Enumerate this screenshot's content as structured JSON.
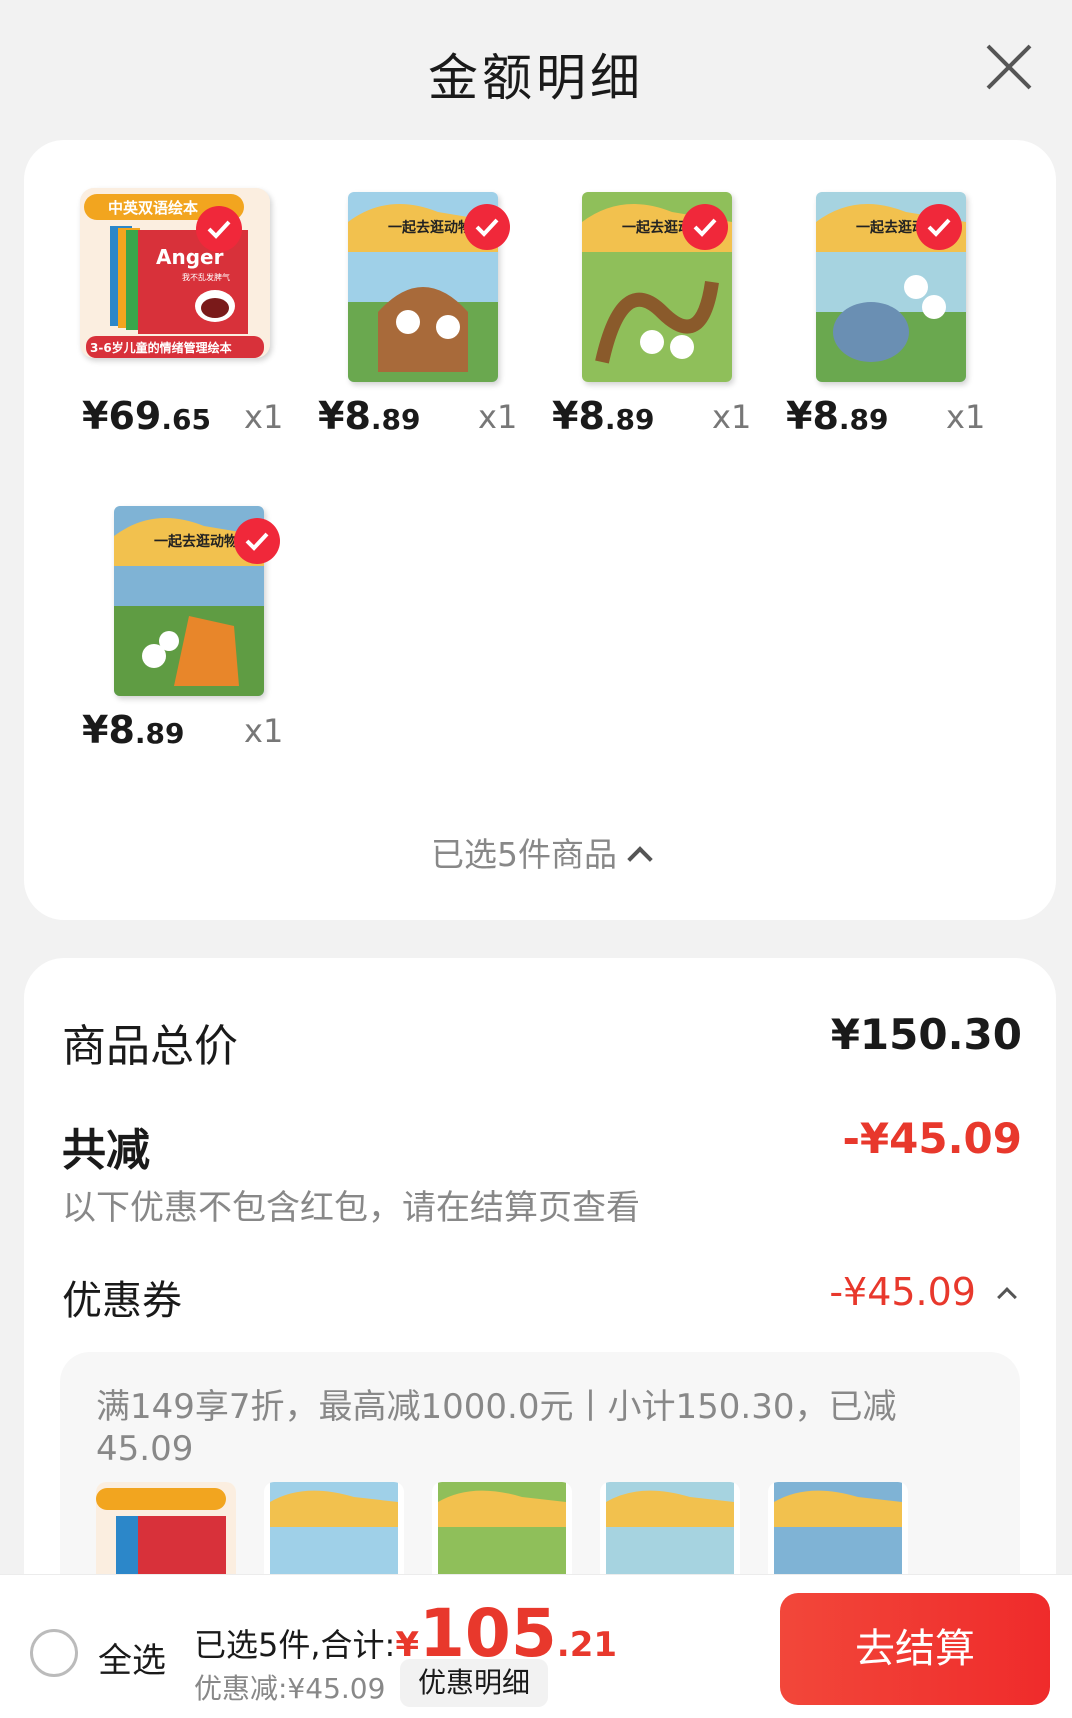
{
  "header": {
    "title": "金额明细",
    "close_icon": "close-icon"
  },
  "items": [
    {
      "price_int": "¥69",
      "price_dec": ".65",
      "qty": "x1",
      "cover_top": "中英双语绘本",
      "cover_title": "Anger",
      "cover_sub": "我不乱发脾气",
      "cover_bottom": "3-6岁儿童的情绪管理绘本"
    },
    {
      "price_int": "¥8",
      "price_dec": ".89",
      "qty": "x1",
      "cover_title": "一起去逛动物园"
    },
    {
      "price_int": "¥8",
      "price_dec": ".89",
      "qty": "x1",
      "cover_title": "一起去逛动物园"
    },
    {
      "price_int": "¥8",
      "price_dec": ".89",
      "qty": "x1",
      "cover_title": "一起去逛动物园"
    },
    {
      "price_int": "¥8",
      "price_dec": ".89",
      "qty": "x1",
      "cover_title": "一起去逛动物园"
    }
  ],
  "selected_summary": "已选5件商品",
  "summary": {
    "goods_total_label": "商品总价",
    "goods_total_value": "¥150.30",
    "reduction_label": "共减",
    "reduction_value": "-¥45.09",
    "reduction_note": "以下优惠不包含红包，请在结算页查看",
    "coupon_label": "优惠券",
    "coupon_value": "-¥45.09",
    "coupon_desc": "满149享7折，最高减1000.0元丨小计150.30，已减45.09"
  },
  "bottom": {
    "select_all": "全选",
    "selected_total_label": "已选5件,合计:",
    "currency": "¥",
    "total_int": "105",
    "total_dec": ".21",
    "discount_text": "优惠减:¥45.09",
    "detail_chip": "优惠明细",
    "checkout": "去结算"
  },
  "colors": {
    "accent_red": "#e8382c",
    "button_red": "#ef2b2b",
    "check_red": "#f0283a"
  }
}
